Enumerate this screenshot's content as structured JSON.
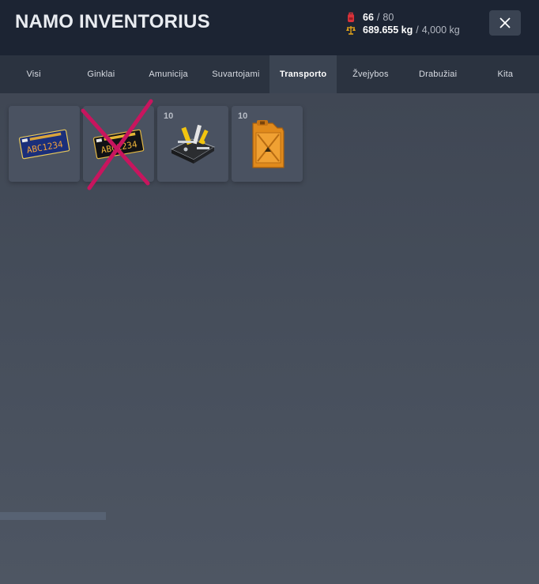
{
  "header": {
    "title": "NAMO INVENTORIUS",
    "slots_used": "66",
    "slots_max": "80",
    "weight_used": "689.655 kg",
    "weight_max": "4,000 kg",
    "slots_icon": "backpack-icon",
    "weight_icon": "weight-scale-icon",
    "close_icon": "close-icon"
  },
  "tabs": [
    {
      "label": "Visi",
      "active": false
    },
    {
      "label": "Ginklai",
      "active": false
    },
    {
      "label": "Amunicija",
      "active": false
    },
    {
      "label": "Suvartojami",
      "active": false
    },
    {
      "label": "Transporto",
      "active": true
    },
    {
      "label": "Žvejybos",
      "active": false
    },
    {
      "label": "Drabužiai",
      "active": false
    },
    {
      "label": "Kita",
      "active": false
    }
  ],
  "items": [
    {
      "name": "license-plate-blue",
      "count": "",
      "plate_text": "ABC1234",
      "crossed": false
    },
    {
      "name": "license-plate-black",
      "count": "",
      "plate_text": "ABC1234",
      "crossed": true
    },
    {
      "name": "toolkit",
      "count": "10",
      "crossed": false
    },
    {
      "name": "jerry-can",
      "count": "10",
      "crossed": false
    }
  ],
  "colors": {
    "header_bg": "#1c2433",
    "tabs_bg": "#2b3340",
    "active_tab_bg": "#3b4452",
    "slot_bg": "#4a5261",
    "cross_mark": "#c8155e"
  }
}
